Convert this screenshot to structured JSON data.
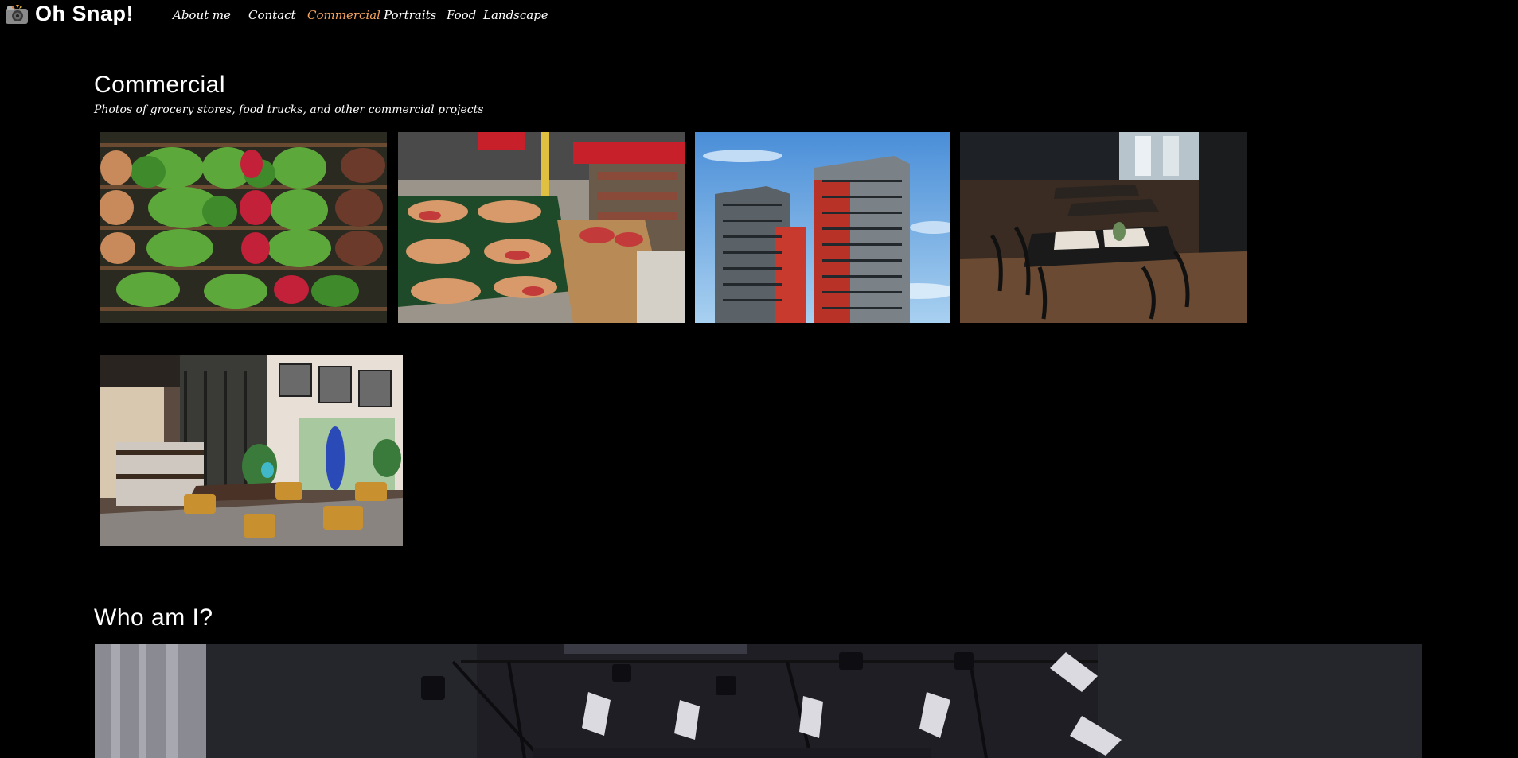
{
  "header": {
    "site_title": "Oh Snap!",
    "logo_icon": "camera-icon"
  },
  "nav": {
    "items": [
      {
        "label": "About me",
        "active": false
      },
      {
        "label": "Contact",
        "active": false
      },
      {
        "label": "Commercial",
        "active": true
      },
      {
        "label": "Portraits",
        "active": false
      },
      {
        "label": "Food",
        "active": false
      },
      {
        "label": "Landscape",
        "active": false
      }
    ],
    "active_color": "#f5a25d"
  },
  "gallery": {
    "title": "Commercial",
    "subtitle": "Photos of grocery stores, food trucks, and other commercial projects",
    "photos": [
      {
        "subject": "produce-shelves-photo"
      },
      {
        "subject": "supermarket-aisle-photo"
      },
      {
        "subject": "apartment-tower-photo"
      },
      {
        "subject": "restaurant-dining-room-photo"
      },
      {
        "subject": "cafe-interior-photo"
      }
    ]
  },
  "about": {
    "title": "Who am I?",
    "hero": "studio-lights-photo"
  },
  "colors": {
    "background": "#000000",
    "text": "#ffffff",
    "accent": "#f5a25d"
  }
}
